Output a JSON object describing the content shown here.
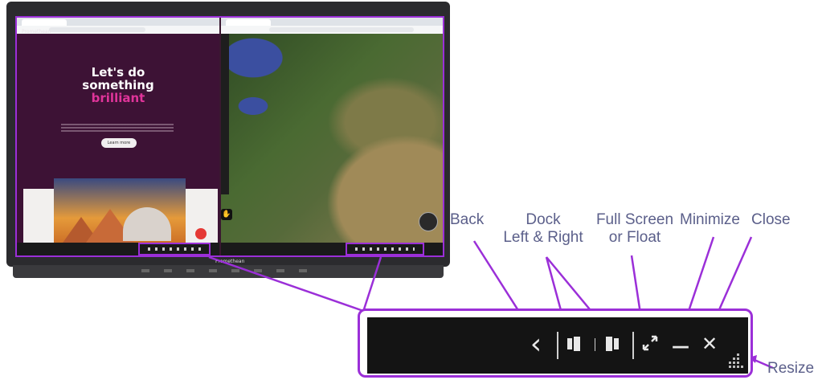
{
  "screen": {
    "left_window": {
      "site_name": "Promethean",
      "hero_line1": "Let's do",
      "hero_line2": "something",
      "hero_accent": "brilliant",
      "cta_label": "Learn more"
    },
    "brand_label": "Promethean"
  },
  "callouts": {
    "back": "Back",
    "dock_line1": "Dock",
    "dock_line2": "Left & Right",
    "fullscreen_line1": "Full Screen",
    "fullscreen_line2": "or Float",
    "minimize": "Minimize",
    "close": "Close",
    "resize": "Resize"
  },
  "toolbar": {
    "back_icon": "‹",
    "minimize_icon": "—",
    "close_icon": "✕"
  },
  "colors": {
    "accent_purple": "#9b2fd8",
    "label_color": "#5b5f8a",
    "toolbar_bg": "#141414",
    "hero_bg": "#3d1235",
    "hero_accent": "#e0349a"
  }
}
